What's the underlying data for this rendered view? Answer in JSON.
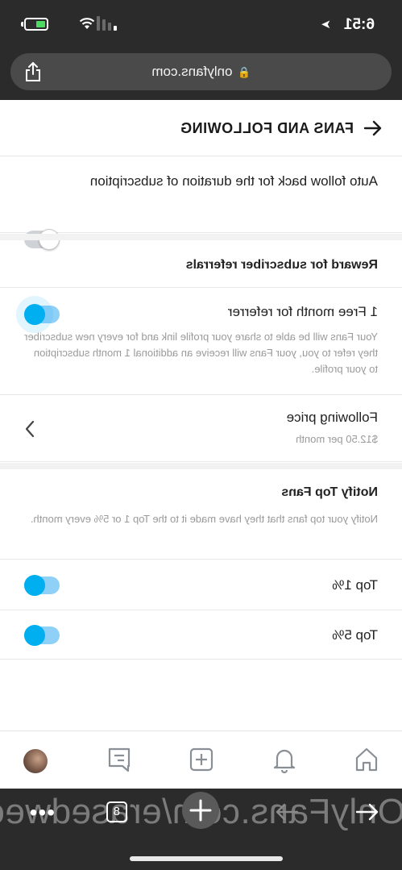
{
  "status_bar": {
    "time": "6:51",
    "location_glyph": "➤",
    "signal_bars": 4,
    "wifi": "wifi-icon",
    "battery": "battery-charging-icon"
  },
  "browser": {
    "url": "onlyfans.com",
    "lock_glyph": "🔒",
    "share_icon": "share-icon"
  },
  "page": {
    "title": "FANS AND FOLLOWING",
    "auto_follow": {
      "label": "Auto follow back for the duration of subscription",
      "enabled": false
    },
    "referrals": {
      "heading": "Reward for subscriber referrals",
      "free_month": {
        "label": "1 Free month for referrer",
        "description": "Your Fans will be able to share your profile link and for every new subscriber they refer to you, your Fans will receive an additional 1 month subscription to your profile.",
        "enabled": true
      }
    },
    "following_price": {
      "label": "Following price",
      "value": "$12.50 per month"
    },
    "notify_top_fans": {
      "heading": "Notify Top Fans",
      "description": "Notify your top fans that they have made it to the Top 1 or 5% every month.",
      "options": [
        {
          "label": "Top 1%",
          "enabled": true
        },
        {
          "label": "Top 5%",
          "enabled": true
        }
      ]
    }
  },
  "bottom_nav": [
    "home-icon",
    "notifications-icon",
    "add-post-icon",
    "messages-icon",
    "profile-avatar"
  ],
  "browser_toolbar": {
    "tab_count": "8",
    "more_label": "•••",
    "watermark": "OnlyFans.com/erasedweeab"
  },
  "colors": {
    "accent": "#00aff0",
    "accent_track": "#8fd0f7",
    "chrome": "#2b2b2b",
    "divider": "#f2f2f2"
  }
}
